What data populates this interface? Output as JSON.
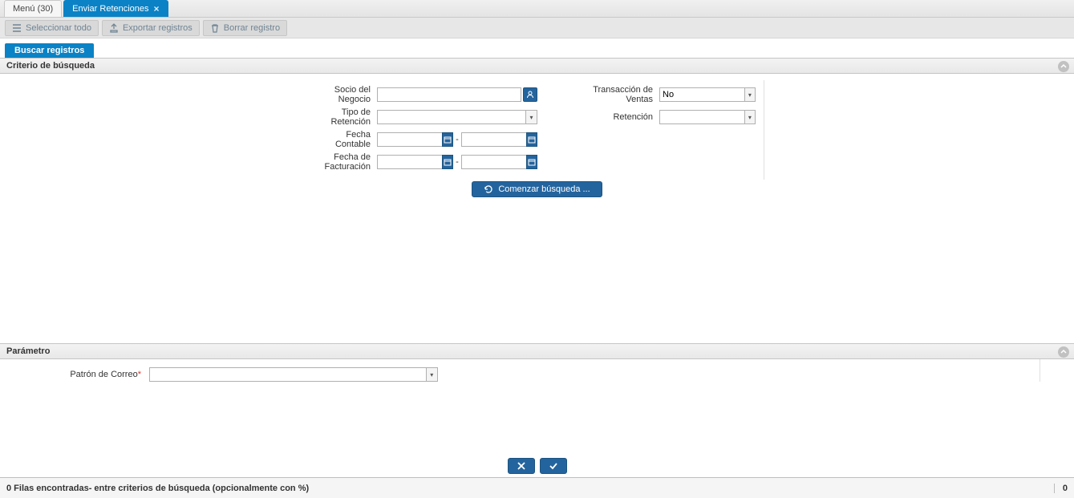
{
  "tabs": {
    "menu": "Menú (30)",
    "active": "Enviar Retenciones"
  },
  "toolbar": {
    "select_all": "Seleccionar todo",
    "export": "Exportar registros",
    "delete": "Borrar registro"
  },
  "subtab": {
    "search": "Buscar registros"
  },
  "sections": {
    "criteria": "Criterio de búsqueda",
    "param": "Parámetro"
  },
  "labels": {
    "partner": "Socio del Negocio",
    "withholding_type": "Tipo de Retención",
    "acct_date": "Fecha Contable",
    "invoice_date": "Fecha de Facturación",
    "sales_trx": "Transacción de Ventas",
    "withholding": "Retención",
    "mail_pattern": "Patrón de Correo"
  },
  "values": {
    "partner": "",
    "withholding_type": "",
    "acct_date_from": "",
    "acct_date_to": "",
    "invoice_date_from": "",
    "invoice_date_to": "",
    "sales_trx": "No",
    "withholding": "",
    "mail_pattern": ""
  },
  "buttons": {
    "search": "Comenzar búsqueda ..."
  },
  "status": {
    "text": "0 Filas encontradas- entre criterios de búsqueda (opcionalmente con %)",
    "count": "0"
  }
}
